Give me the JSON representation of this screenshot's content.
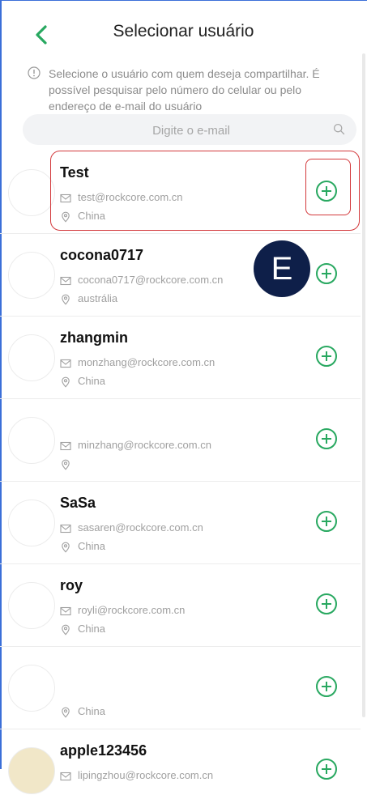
{
  "header": {
    "title": "Selecionar usuário"
  },
  "hint": {
    "text": "Selecione o usuário com quem deseja compartilhar. É possível pesquisar pelo número do celular ou pelo endereço de e-mail do usuário"
  },
  "search": {
    "placeholder": "Digite o e-mail"
  },
  "badge": {
    "letter": "E"
  },
  "colors": {
    "accent": "#28a860",
    "highlight": "#d3393c",
    "badge": "#0e1f49"
  },
  "users": [
    {
      "name": "Test",
      "email": "test@rockcore.com.cn",
      "location": "China"
    },
    {
      "name": "cocona0717",
      "email": "cocona0717@rockcore.com.cn",
      "location": "austrália"
    },
    {
      "name": "zhangmin",
      "email": "monzhang@rockcore.com.cn",
      "location": "China"
    },
    {
      "name": "",
      "email": "minzhang@rockcore.com.cn",
      "location": ""
    },
    {
      "name": "SaSa",
      "email": "sasaren@rockcore.com.cn",
      "location": "China"
    },
    {
      "name": "roy",
      "email": "royli@rockcore.com.cn",
      "location": "China"
    },
    {
      "name": "",
      "email": "",
      "location": "China"
    },
    {
      "name": "apple123456",
      "email": "lipingzhou@rockcore.com.cn",
      "location": ""
    }
  ]
}
